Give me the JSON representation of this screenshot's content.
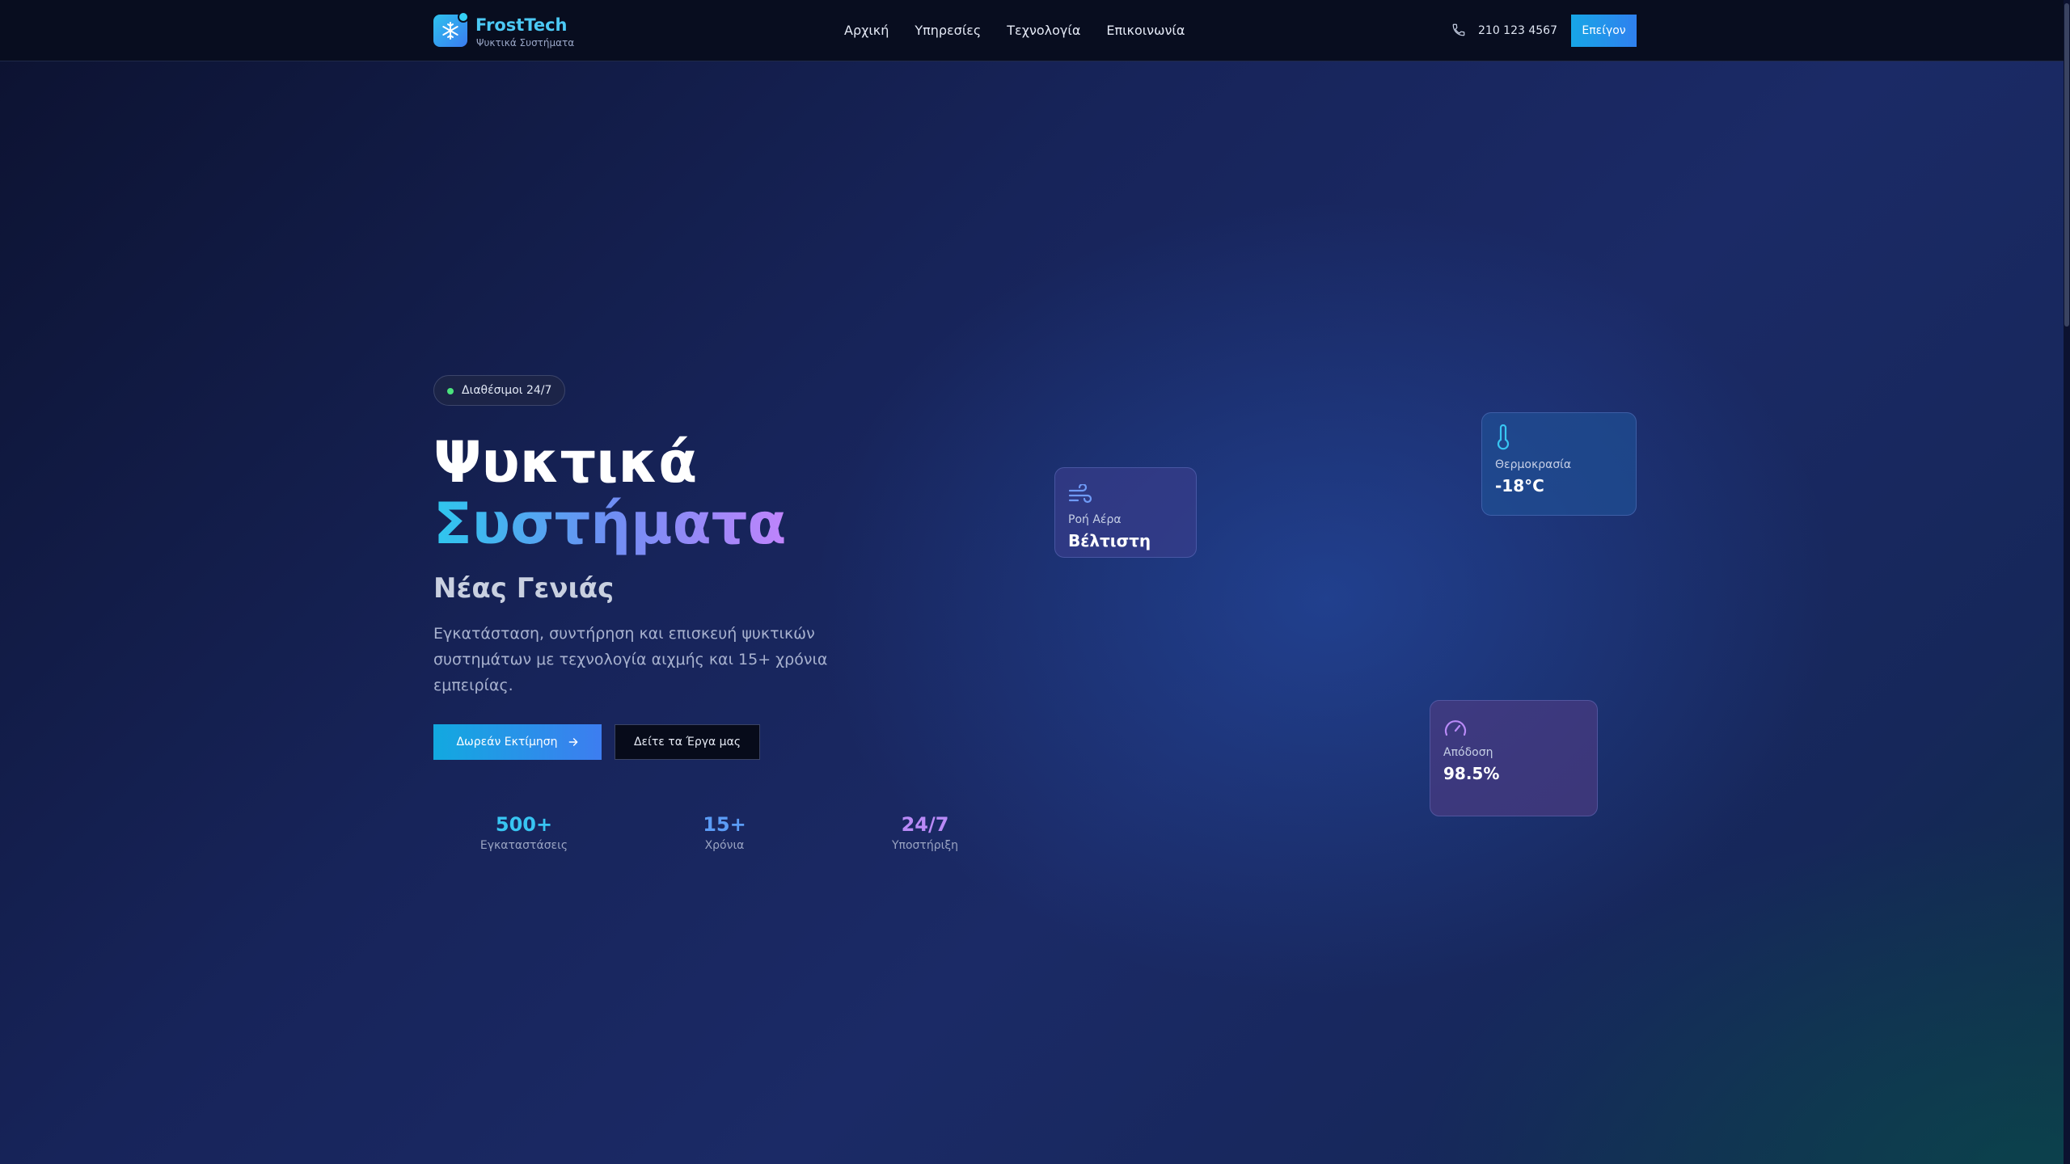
{
  "nav": {
    "brand_name": "FrostTech",
    "brand_sub": "Ψυκτικά Συστήματα",
    "links": [
      "Αρχική",
      "Υπηρεσίες",
      "Τεχνολογία",
      "Επικοινωνία"
    ],
    "phone": "210 123 4567",
    "cta": "Επείγον"
  },
  "hero": {
    "badge": "Διαθέσιμοι 24/7",
    "title_line1": "Ψυκτικά",
    "title_line2": "Συστήματα",
    "subtitle": "Νέας Γενιάς",
    "lead": "Εγκατάσταση, συντήρηση και επισκευή ψυκτικών συστημάτων με τεχνολογία αιχμής και 15+ χρόνια εμπειρίας.",
    "primary_button": "Δωρεάν Εκτίμηση",
    "secondary_button": "Δείτε τα Έργα μας",
    "stats": [
      {
        "value": "500+",
        "label": "Εγκαταστάσεις",
        "color": "#38c5f2"
      },
      {
        "value": "15+",
        "label": "Χρόνια",
        "color": "#5b9cf6"
      },
      {
        "value": "24/7",
        "label": "Υποστήριξη",
        "color": "#b98af7"
      }
    ]
  },
  "cards": {
    "air": {
      "label": "Ροή Αέρα",
      "value": "Βέλτιστη",
      "icon": "wind-icon"
    },
    "temp": {
      "label": "Θερμοκρασία",
      "value": "-18°C",
      "icon": "thermometer-icon"
    },
    "perf": {
      "label": "Απόδοση",
      "value": "98.5%",
      "icon": "gauge-icon"
    }
  },
  "colors": {
    "accent_cyan": "#2ec7ee",
    "accent_blue": "#3d7df0",
    "accent_purple": "#c084fc",
    "status_green": "#4be37d"
  }
}
